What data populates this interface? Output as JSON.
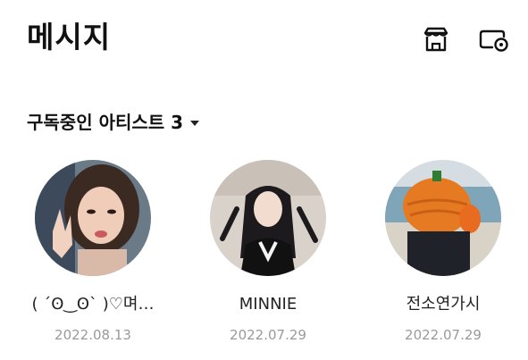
{
  "header": {
    "title": "메시지",
    "store_icon": "store-icon",
    "settings_icon": "chat-settings-icon"
  },
  "section": {
    "label": "구독중인 아티스트 3",
    "caret_icon": "caret-down-icon"
  },
  "artists": [
    {
      "name": "( ´ʘ‿ʘ` )♡며…",
      "date": "2022.08.13"
    },
    {
      "name": "MINNIE",
      "date": "2022.07.29"
    },
    {
      "name": "전소연가시",
      "date": "2022.07.29"
    }
  ]
}
